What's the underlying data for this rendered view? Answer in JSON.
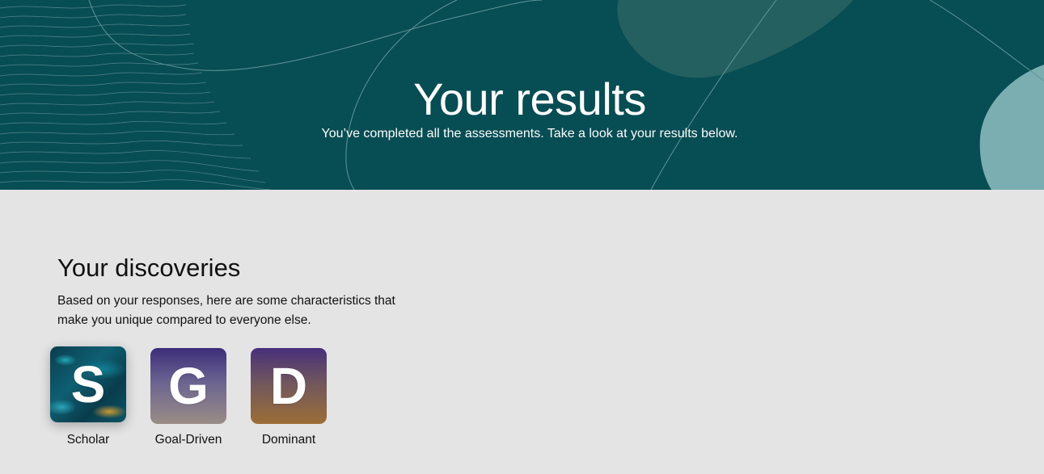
{
  "hero": {
    "title": "Your results",
    "subtitle": "You’ve completed all the assessments. Take a look at your results below.",
    "background_color": "#074d54"
  },
  "discoveries": {
    "title": "Your discoveries",
    "description": "Based on your responses, here are some characteristics that make you unique compared to everyone else.",
    "traits": [
      {
        "letter": "S",
        "label": "Scholar",
        "selected": true
      },
      {
        "letter": "G",
        "label": "Goal-Driven",
        "selected": false
      },
      {
        "letter": "D",
        "label": "Dominant",
        "selected": false
      }
    ]
  },
  "colors": {
    "page_background": "#e4e4e4",
    "hero_accent_light": "#7aaeb1",
    "hero_accent_mid": "#23605f"
  }
}
